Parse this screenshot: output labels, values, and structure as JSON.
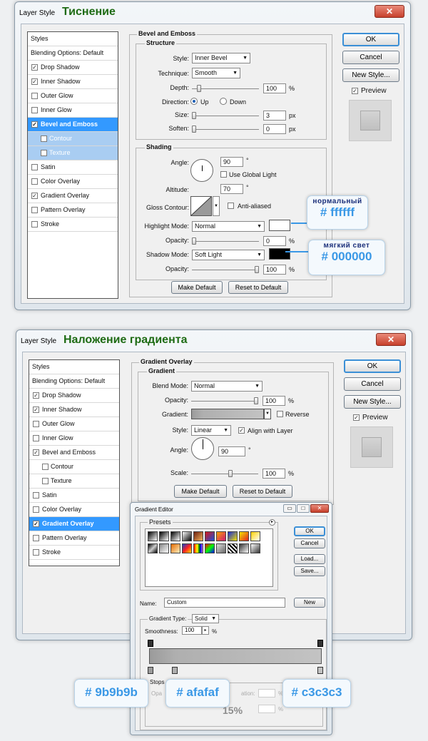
{
  "colors": {
    "accent": "#3399ff",
    "title_green": "#1e6b14",
    "callout_blue": "#3a98e6",
    "highlight": "#ffffff",
    "shadow": "#000000"
  },
  "bevel_window": {
    "title": "Layer Style",
    "title_ru": "Тиснение",
    "close_glyph": "✕",
    "styles_list": [
      {
        "label": "Styles",
        "checked": null
      },
      {
        "label": "Blending Options: Default",
        "checked": null
      },
      {
        "label": "Drop Shadow",
        "checked": true
      },
      {
        "label": "Inner Shadow",
        "checked": true
      },
      {
        "label": "Outer Glow",
        "checked": false
      },
      {
        "label": "Inner Glow",
        "checked": false
      },
      {
        "label": "Bevel and Emboss",
        "checked": true,
        "selected": true
      },
      {
        "label": "Contour",
        "checked": false,
        "sub": true
      },
      {
        "label": "Texture",
        "checked": false,
        "sub": true
      },
      {
        "label": "Satin",
        "checked": false
      },
      {
        "label": "Color Overlay",
        "checked": false
      },
      {
        "label": "Gradient Overlay",
        "checked": true
      },
      {
        "label": "Pattern Overlay",
        "checked": false
      },
      {
        "label": "Stroke",
        "checked": false
      }
    ],
    "group_title": "Bevel and Emboss",
    "structure": {
      "title": "Structure",
      "style_label": "Style:",
      "style_value": "Inner Bevel",
      "technique_label": "Technique:",
      "technique_value": "Smooth",
      "depth_label": "Depth:",
      "depth_value": "100",
      "depth_unit": "%",
      "direction_label": "Direction:",
      "direction_up": "Up",
      "direction_down": "Down",
      "size_label": "Size:",
      "size_value": "3",
      "size_unit": "px",
      "soften_label": "Soften:",
      "soften_value": "0",
      "soften_unit": "px"
    },
    "shading": {
      "title": "Shading",
      "angle_label": "Angle:",
      "angle_value": "90",
      "angle_unit": "°",
      "use_global": "Use Global Light",
      "altitude_label": "Altitude:",
      "altitude_value": "70",
      "altitude_unit": "°",
      "gloss_label": "Gloss Contour:",
      "anti_aliased": "Anti-aliased",
      "highlight_label": "Highlight Mode:",
      "highlight_value": "Normal",
      "opacity_label": "Opacity:",
      "highlight_opacity": "0",
      "opacity_unit": "%",
      "shadow_label": "Shadow Mode:",
      "shadow_value": "Soft Light",
      "shadow_opacity": "100"
    },
    "make_default": "Make Default",
    "reset_default": "Reset to Default",
    "ok": "OK",
    "cancel": "Cancel",
    "new_style": "New Style...",
    "preview": "Preview",
    "callout_highlight": {
      "top": "нормальный",
      "hex": "# ffffff"
    },
    "callout_shadow": {
      "top": "мягкий свет",
      "hex": "# 000000"
    }
  },
  "gradient_window": {
    "title": "Layer Style",
    "title_ru": "Наложение градиента",
    "close_glyph": "✕",
    "styles_list": [
      {
        "label": "Styles",
        "checked": null
      },
      {
        "label": "Blending Options: Default",
        "checked": null
      },
      {
        "label": "Drop Shadow",
        "checked": true
      },
      {
        "label": "Inner Shadow",
        "checked": true
      },
      {
        "label": "Outer Glow",
        "checked": false
      },
      {
        "label": "Inner Glow",
        "checked": false
      },
      {
        "label": "Bevel and Emboss",
        "checked": true
      },
      {
        "label": "Contour",
        "checked": false,
        "sub2": true
      },
      {
        "label": "Texture",
        "checked": false,
        "sub2": true
      },
      {
        "label": "Satin",
        "checked": false
      },
      {
        "label": "Color Overlay",
        "checked": false
      },
      {
        "label": "Gradient Overlay",
        "checked": true,
        "selected": true
      },
      {
        "label": "Pattern Overlay",
        "checked": false
      },
      {
        "label": "Stroke",
        "checked": false
      }
    ],
    "group_title": "Gradient Overlay",
    "gradient": {
      "title": "Gradient",
      "blend_label": "Blend Mode:",
      "blend_value": "Normal",
      "opacity_label": "Opacity:",
      "opacity_value": "100",
      "opacity_unit": "%",
      "gradient_label": "Gradient:",
      "reverse": "Reverse",
      "style_label": "Style:",
      "style_value": "Linear",
      "align": "Align with Layer",
      "angle_label": "Angle:",
      "angle_value": "90",
      "angle_unit": "°",
      "scale_label": "Scale:",
      "scale_value": "100",
      "scale_unit": "%"
    },
    "make_default": "Make Default",
    "reset_default": "Reset to Default",
    "ok": "OK",
    "cancel": "Cancel",
    "new_style": "New Style...",
    "preview": "Preview"
  },
  "gradient_editor": {
    "title": "Gradient Editor",
    "presets_label": "Presets",
    "ok": "OK",
    "cancel": "Cancel",
    "load": "Load...",
    "save": "Save...",
    "name_label": "Name:",
    "name_value": "Custom",
    "new_button": "New",
    "type_label": "Gradient Type:",
    "type_value": "Solid",
    "smoothness_label": "Smoothness:",
    "smoothness_value": "100",
    "smoothness_unit": "%",
    "stops_label": "Stops",
    "opacity_label": "Opa",
    "location_label": "ation:",
    "location_unit": "%",
    "location_value": "15%"
  },
  "callouts_gradient": [
    "# 9b9b9b",
    "# afafaf",
    "# c3c3c3"
  ]
}
